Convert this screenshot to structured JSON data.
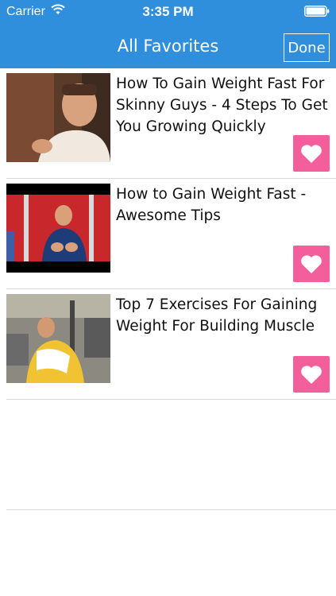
{
  "status_bar": {
    "carrier": "Carrier",
    "time": "3:35 PM",
    "wifi_icon": "wifi-icon",
    "battery_icon": "battery-icon"
  },
  "nav": {
    "title": "All Favorites",
    "done_label": "Done"
  },
  "colors": {
    "nav_background": "#2f8fdd",
    "favorite_button": "#f25f9a"
  },
  "favorites": [
    {
      "title": "How To Gain Weight Fast For Skinny Guys - 4 Steps To Get You Growing Quickly",
      "icon": "heart-icon"
    },
    {
      "title": "How to Gain Weight Fast - Awesome Tips",
      "icon": "heart-icon"
    },
    {
      "title": "Top 7 Exercises For Gaining Weight For Building Muscle",
      "icon": "heart-icon"
    }
  ]
}
